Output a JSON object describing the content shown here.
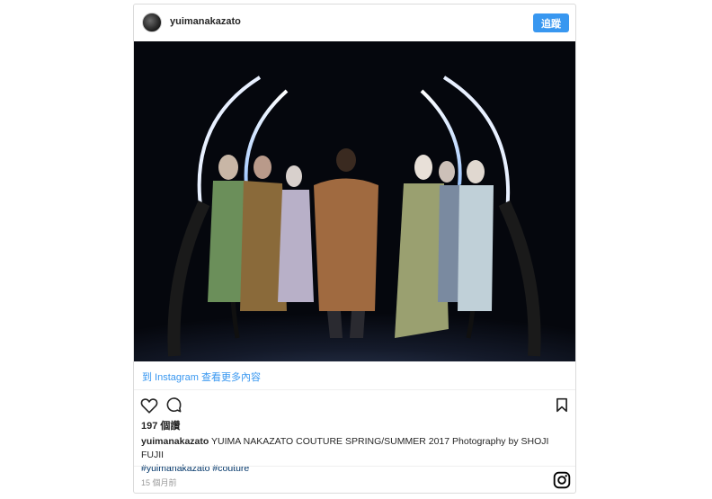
{
  "post": {
    "username": "yuimanakazato",
    "follow_label": "追蹤",
    "view_more": "到 Instagram 查看更多內容",
    "likes": "197 個讚",
    "caption_user": "yuimanakazato",
    "caption_text": "YUIMA NAKAZATO COUTURE SPRING/SUMMER 2017 Photography by SHOJI FUJII",
    "hashtags": [
      "#yuimanakazato",
      "#couture"
    ],
    "timestamp": "15 個月前"
  },
  "icons": {
    "avatar": "avatar",
    "like": "heart-icon",
    "comment": "comment-icon",
    "save": "bookmark-icon",
    "instagram": "instagram-logo-icon"
  },
  "colors": {
    "accent": "#3897f0",
    "border": "#dbdbdb",
    "hashtag": "#003569",
    "muted": "#999999"
  }
}
